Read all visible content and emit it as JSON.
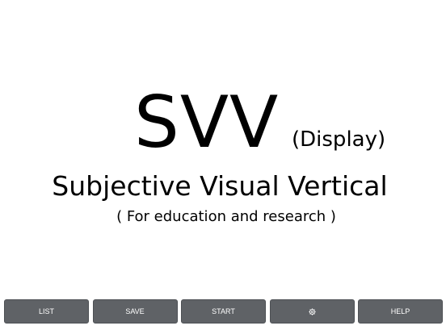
{
  "title": {
    "main": "SVV",
    "sub": "(Display)"
  },
  "subtitle": "Subjective Visual Vertical",
  "note": "( For education and research )",
  "toolbar": {
    "list_label": "LIST",
    "save_label": "SAVE",
    "start_label": "START",
    "settings_icon": "gear-icon",
    "help_label": "HELP"
  },
  "colors": {
    "button_bg": "#5f6266",
    "button_text": "#ffffff",
    "background": "#ffffff",
    "text": "#000000"
  }
}
